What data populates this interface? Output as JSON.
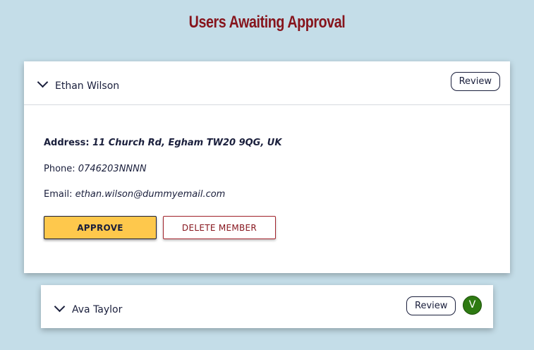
{
  "page": {
    "title": "Users Awaiting Approval"
  },
  "members": [
    {
      "name": "Ethan Wilson",
      "review_label": "Review",
      "expanded": true,
      "address_label": "Address:",
      "address": "11 Church Rd, Egham TW20 9QG, UK",
      "phone_label": "Phone:",
      "phone": "0746203NNNN",
      "email_label": "Email:",
      "email": "ethan.wilson@dummyemail.com",
      "approve_label": "APPROVE",
      "delete_label": "DELETE MEMBER"
    },
    {
      "name": "Ava Taylor",
      "review_label": "Review",
      "expanded": false,
      "badge": "V"
    }
  ],
  "colors": {
    "background": "#c4dde8",
    "title": "#86141c",
    "approve": "#fec84c",
    "delete": "#86141c",
    "verified_badge": "#2e7a12"
  },
  "icons": {
    "expand": "chevron-down-icon"
  }
}
